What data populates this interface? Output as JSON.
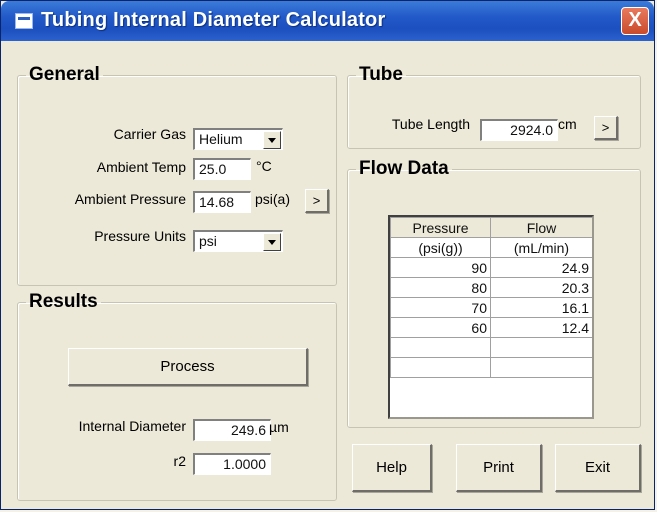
{
  "window": {
    "title": "Tubing Internal Diameter Calculator",
    "close_glyph": "X"
  },
  "general": {
    "legend": "General",
    "carrier_gas": {
      "label": "Carrier Gas",
      "value": "Helium"
    },
    "ambient_temp": {
      "label": "Ambient Temp",
      "value": "25.0",
      "unit": "°C"
    },
    "ambient_pressure": {
      "label": "Ambient Pressure",
      "value": "14.68",
      "unit": "psi(a)",
      "button": ">"
    },
    "pressure_units": {
      "label": "Pressure Units",
      "value": "psi"
    }
  },
  "results": {
    "legend": "Results",
    "process_button": "Process",
    "internal_diameter": {
      "label": "Internal Diameter",
      "value": "249.6",
      "unit": "µm"
    },
    "r2": {
      "label": "r2",
      "value": "1.0000"
    }
  },
  "tube": {
    "legend": "Tube",
    "tube_length": {
      "label": "Tube Length",
      "value": "2924.0",
      "unit": "cm",
      "button": ">"
    }
  },
  "flow_data": {
    "legend": "Flow Data",
    "columns": [
      {
        "title": "Pressure",
        "unit": "(psi(g))"
      },
      {
        "title": "Flow",
        "unit": "(mL/min)"
      }
    ],
    "rows": [
      [
        "90",
        "24.9"
      ],
      [
        "80",
        "20.3"
      ],
      [
        "70",
        "16.1"
      ],
      [
        "60",
        "12.4"
      ],
      [
        "",
        ""
      ],
      [
        "",
        ""
      ]
    ]
  },
  "buttons": {
    "help": "Help",
    "print": "Print",
    "exit": "Exit"
  },
  "icons": {
    "app": "app-window-icon",
    "close": "close-icon",
    "dropdown": "chevron-down-icon"
  }
}
